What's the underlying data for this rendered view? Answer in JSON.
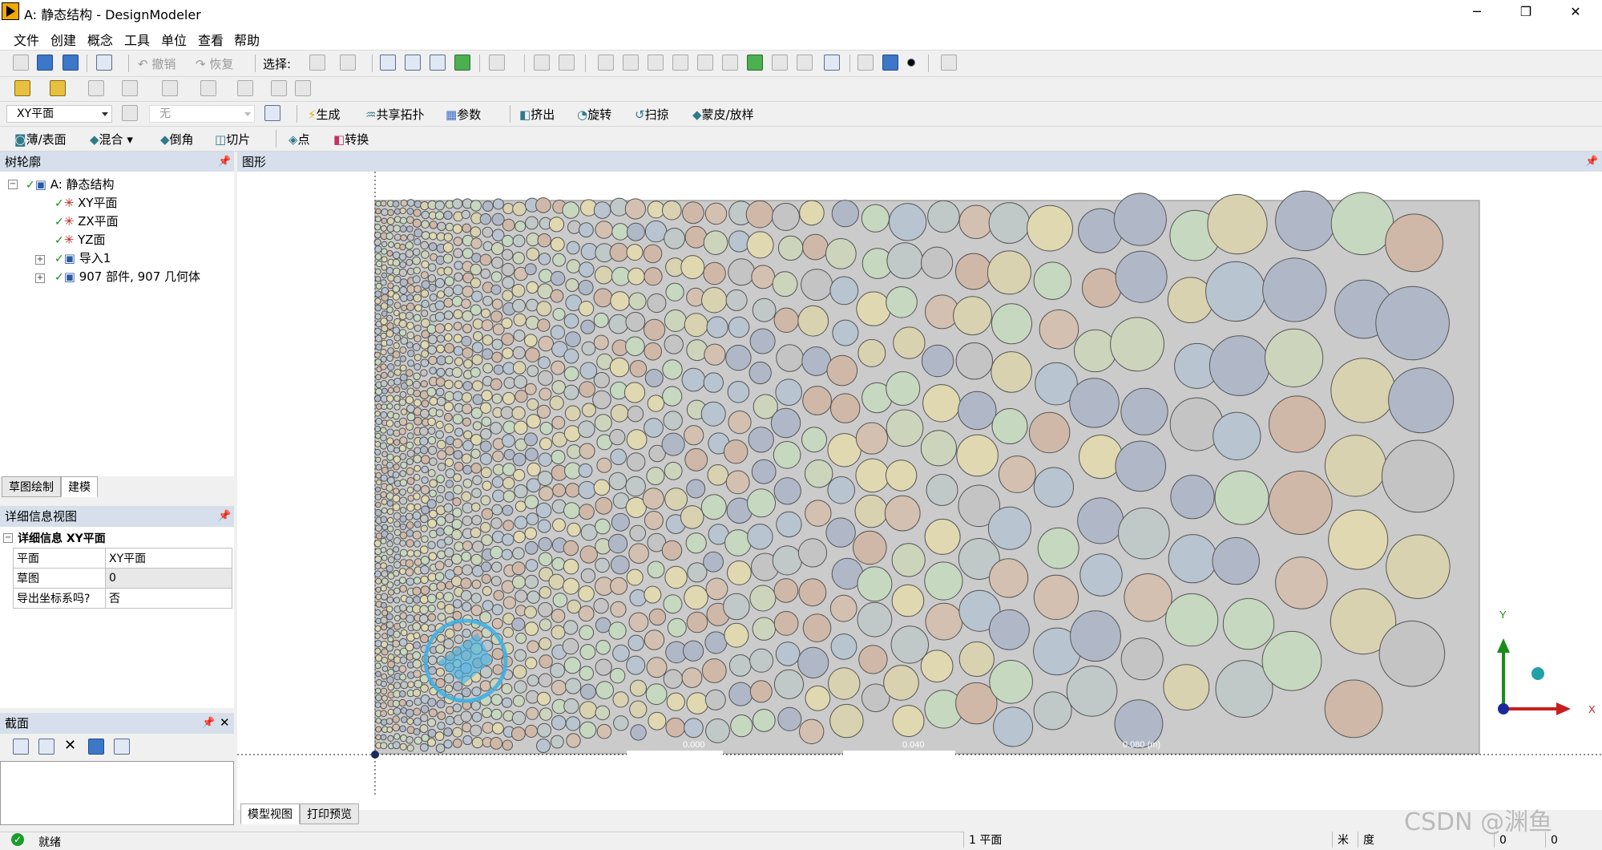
{
  "window": {
    "title": "A: 静态结构 - DesignModeler"
  },
  "menu": [
    "文件",
    "创建",
    "概念",
    "工具",
    "单位",
    "查看",
    "帮助"
  ],
  "toolbar1": {
    "undo": "撤销",
    "redo": "恢复",
    "select_label": "选择:"
  },
  "toolbar3": {
    "plane": "XY平面",
    "sketch": "无",
    "generate": "生成",
    "share_topology": "共享拓扑",
    "parameters": "参数",
    "extrude": "挤出",
    "revolve": "旋转",
    "sweep": "扫掠",
    "skin_loft": "蒙皮/放样"
  },
  "toolbar4": {
    "thin_surface": "薄/表面",
    "blend": "混合",
    "chamfer": "倒角",
    "slice": "切片",
    "point": "点",
    "convert": "转换"
  },
  "tree": {
    "header": "树轮廓",
    "root": "A: 静态结构",
    "items": [
      "XY平面",
      "ZX平面",
      "YZ面",
      "导入1",
      "907 部件, 907 几何体"
    ]
  },
  "tabs": {
    "sketching": "草图绘制",
    "modeling": "建模"
  },
  "details": {
    "header": "详细信息视图",
    "group": "详细信息 XY平面",
    "rows": [
      [
        "平面",
        "XY平面"
      ],
      [
        "草图",
        "0"
      ],
      [
        "导出坐标系吗?",
        "否"
      ]
    ]
  },
  "section": {
    "header": "截面"
  },
  "graphics": {
    "header": "图形",
    "axis_y": "Y",
    "axis_x": "X",
    "scale_labels": [
      "0.000",
      "0.040",
      "0.080 (m)"
    ]
  },
  "bottom_tabs": {
    "model_view": "模型视图",
    "print_preview": "打印预览"
  },
  "status": {
    "ready": "就绪",
    "selection": "1 平面",
    "units": "米",
    "angle": "度",
    "v1": "0",
    "v2": "0"
  },
  "watermark": "CSDN @渊鱼",
  "colors": {
    "panel_header": "#d6dfeb",
    "rect_fill": "#cbcbcb",
    "circle_stroke": "#555555"
  }
}
